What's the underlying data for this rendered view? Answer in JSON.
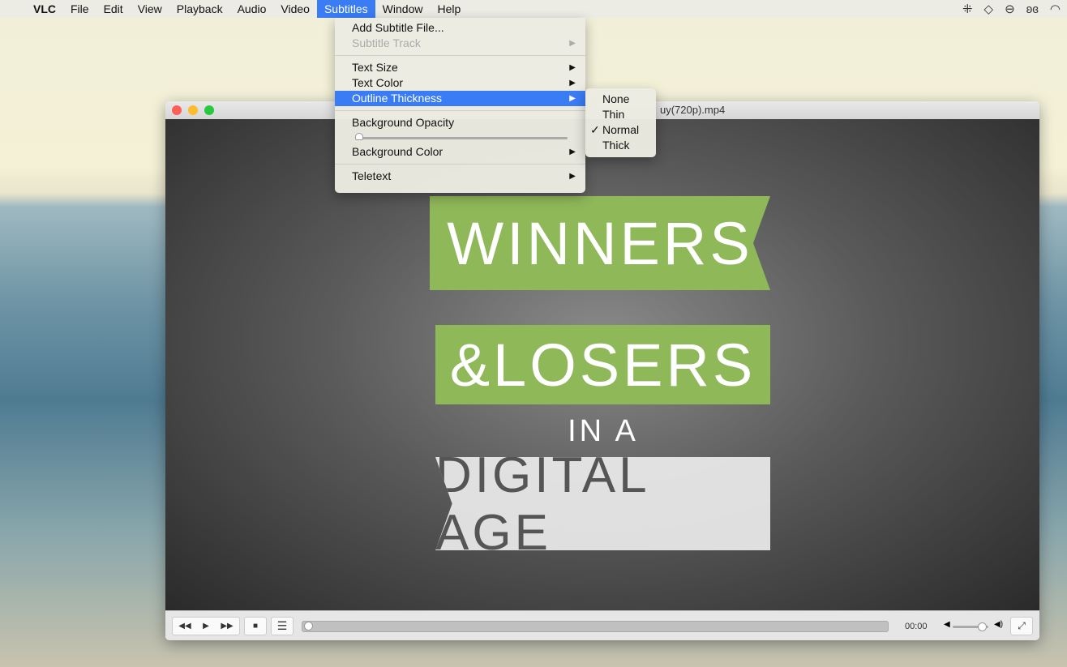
{
  "menubar": {
    "app": "VLC",
    "items": [
      "File",
      "Edit",
      "View",
      "Playback",
      "Audio",
      "Video",
      "Subtitles",
      "Window",
      "Help"
    ],
    "active": "Subtitles",
    "tray_icons": [
      "dropbox-icon",
      "fox-icon",
      "circle-icon",
      "butterfly-icon",
      "wifi-icon"
    ]
  },
  "window": {
    "title": "uy(720p).mp4"
  },
  "video": {
    "line1": "WINNERS",
    "line2": "&LOSERS",
    "line3": "IN A",
    "line4": "DIGITAL AGE",
    "banner_color": "#8fb859"
  },
  "subtitles_menu": {
    "add_file": "Add Subtitle File...",
    "track": "Subtitle Track",
    "text_size": "Text Size",
    "text_color": "Text Color",
    "outline": "Outline Thickness",
    "bg_opacity": "Background Opacity",
    "bg_opacity_value": 0,
    "bg_color": "Background Color",
    "teletext": "Teletext"
  },
  "outline_submenu": {
    "items": [
      "None",
      "Thin",
      "Normal",
      "Thick"
    ],
    "checked": "Normal",
    "check": "✓"
  },
  "controls": {
    "time": "00:00",
    "progress": 0,
    "volume": 0.85
  },
  "colors": {
    "accent": "#3a7cf4"
  }
}
